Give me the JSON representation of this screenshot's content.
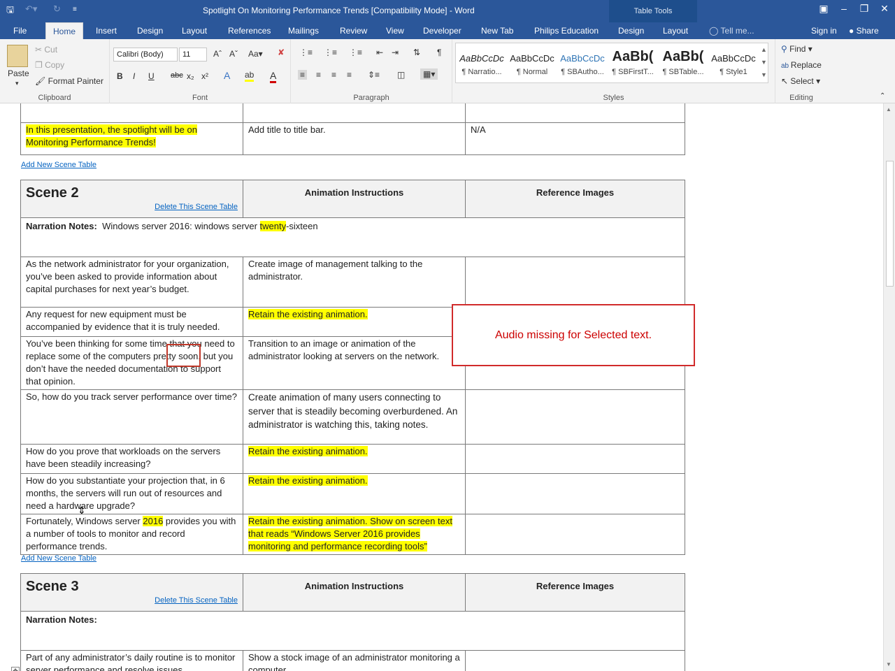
{
  "window": {
    "title": "Spotlight On Monitoring Performance Trends [Compatibility Mode] - Word",
    "context_tab": "Table Tools",
    "quick_access": {
      "save": "save-icon",
      "undo": "undo-icon",
      "redo": "redo-icon",
      "customize": "customize-icon"
    }
  },
  "ribbon_tabs": [
    "File",
    "Home",
    "Insert",
    "Design",
    "Layout",
    "References",
    "Mailings",
    "Review",
    "View",
    "Developer",
    "New Tab",
    "Philips Education",
    "Design",
    "Layout"
  ],
  "ribbon_right": {
    "tell_me": "Tell me...",
    "sign_in": "Sign in",
    "share": "Share"
  },
  "clipboard": {
    "paste": "Paste",
    "cut": "Cut",
    "copy": "Copy",
    "format_painter": "Format Painter",
    "label": "Clipboard"
  },
  "font": {
    "name": "Calibri (Body)",
    "size": "11",
    "label": "Font",
    "buttons": [
      "B",
      "I",
      "U",
      "abc",
      "x₂",
      "x²"
    ]
  },
  "paragraph": {
    "label": "Paragraph"
  },
  "styles": {
    "label": "Styles",
    "items": [
      {
        "preview": "AaBbCcDc",
        "name": "¶ Narratio..."
      },
      {
        "preview": "AaBbCcDc",
        "name": "¶ Normal"
      },
      {
        "preview": "AaBbCcDc",
        "name": "¶ SBAutho..."
      },
      {
        "preview": "AaBb(",
        "name": "¶ SBFirstT..."
      },
      {
        "preview": "AaBb(",
        "name": "¶ SBTable..."
      },
      {
        "preview": "AaBbCcDc",
        "name": "¶ Style1"
      }
    ]
  },
  "editing": {
    "find": "Find",
    "replace": "Replace",
    "select": "Select",
    "label": "Editing"
  },
  "doc": {
    "scene1_partial": {
      "narration": "In this presentation, the spotlight will be on Monitoring Performance Trends!",
      "animation": "Add title to title bar.",
      "reference": "N/A"
    },
    "add_scene": "Add New Scene Table",
    "delete_scene": "Delete This Scene Table",
    "col_animation": "Animation Instructions",
    "col_reference": "Reference Images",
    "narration_label": "Narration Notes:",
    "scene2": {
      "title": "Scene 2",
      "narration_pre": "Windows server 2016: windows server ",
      "narration_hl": "twenty",
      "narration_post": "-sixteen",
      "rows": [
        {
          "n": "As the network administrator for your organization, you’ve been asked to provide information about capital purchases for next year’s budget.",
          "a": "Create image of management talking to the administrator."
        },
        {
          "n": "Any request for new equipment must be accompanied by evidence that it is truly needed.",
          "a": "Retain the existing animation."
        },
        {
          "n": "You’ve been thinking for some time that you need to replace some of the computers pretty soon, but you don’t have the needed documentation to support that opinion.",
          "a": "Transition to an image or animation of the administrator looking at servers on the network."
        },
        {
          "n": "So, how do you track server performance over time?",
          "a": "Create animation of many users connecting to server that is steadily becoming overburdened. An administrator is watching this, taking notes."
        },
        {
          "n": "How do you prove that workloads on the servers have been steadily increasing?",
          "a": "Retain the existing animation."
        },
        {
          "n": "How do you substantiate your projection that, in 6 months, the servers will run out of resources and need a hardware upgrade?",
          "a": "Retain the existing animation."
        }
      ],
      "last_n_pre": "Fortunately, Windows server ",
      "last_n_hl": "2016",
      "last_n_post": " provides you with a number of tools to monitor and record performance trends.",
      "last_a_1": "Retain the existing animation.",
      "last_a_2": " Show on screen text that reads “Windows Server 2016 provides monitoring and performance recording tools”"
    },
    "scene3": {
      "title": "Scene 3",
      "row1_n": "Part of any administrator’s daily routine is to monitor server performance and resolve issues",
      "row1_a": "Show a stock image of an administrator monitoring a computer"
    }
  },
  "popup": {
    "message": "Audio missing for Selected text."
  }
}
